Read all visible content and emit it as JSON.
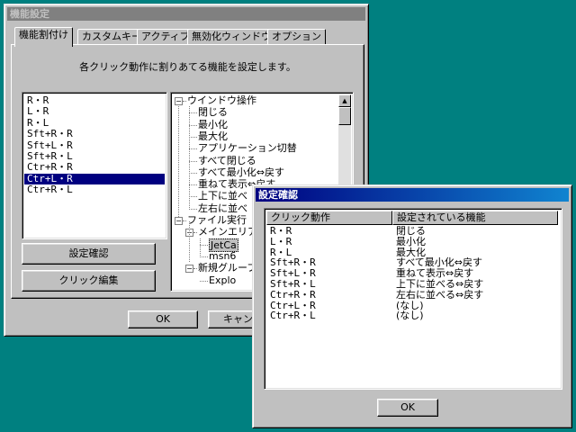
{
  "main_window": {
    "title": "機能設定",
    "tabs": [
      {
        "label": "機能割付け",
        "active": true
      },
      {
        "label": "カスタムキー"
      },
      {
        "label": "アクティブ"
      },
      {
        "label": "無効化ウィンドウ"
      },
      {
        "label": "オプション"
      }
    ],
    "description": "各クリック動作に割りあてる機能を設定します。",
    "click_list": [
      "R・R",
      "L・R",
      "R・L",
      "Sft+R・R",
      "Sft+L・R",
      "Sft+R・L",
      "Ctr+R・R",
      "Ctr+L・R",
      "Ctr+R・L"
    ],
    "selected_click": "Ctr+L・R",
    "tree": {
      "window_ops": "ウインドウ操作",
      "window_ops_items": [
        "閉じる",
        "最小化",
        "最大化",
        "アプリケーション切替",
        "すべて閉じる",
        "すべて最小化⇔戻す",
        "重ねて表示⇔戻す",
        "上下に並べ",
        "左右に並べ"
      ],
      "file_exec": "ファイル実行",
      "main_area": "メインエリア",
      "main_area_items": [
        "JetCa",
        "msn6"
      ],
      "new_group": "新規グループ",
      "new_group_items": [
        "Explo"
      ]
    },
    "buttons": {
      "confirm": "設定確認",
      "edit": "クリック編集",
      "ok": "OK",
      "cancel": "キャンセ"
    }
  },
  "confirm_window": {
    "title": "設定確認",
    "columns": [
      "クリック動作",
      "設定されている機能"
    ],
    "rows": [
      {
        "click": "R・R",
        "func": "閉じる"
      },
      {
        "click": "L・R",
        "func": "最小化"
      },
      {
        "click": "R・L",
        "func": "最大化"
      },
      {
        "click": "Sft+R・R",
        "func": "すべて最小化⇔戻す"
      },
      {
        "click": "Sft+L・R",
        "func": "重ねて表示⇔戻す"
      },
      {
        "click": "Sft+R・L",
        "func": "上下に並べる⇔戻す"
      },
      {
        "click": "Ctr+R・R",
        "func": "左右に並べる⇔戻す"
      },
      {
        "click": "Ctr+L・R",
        "func": "(なし)"
      },
      {
        "click": "Ctr+R・L",
        "func": "(なし)"
      }
    ],
    "ok": "OK"
  },
  "colors": {
    "desktop": "#008080",
    "face": "#c0c0c0",
    "selection": "#000080",
    "active_title": "#000080",
    "inactive_title": "#808080"
  }
}
